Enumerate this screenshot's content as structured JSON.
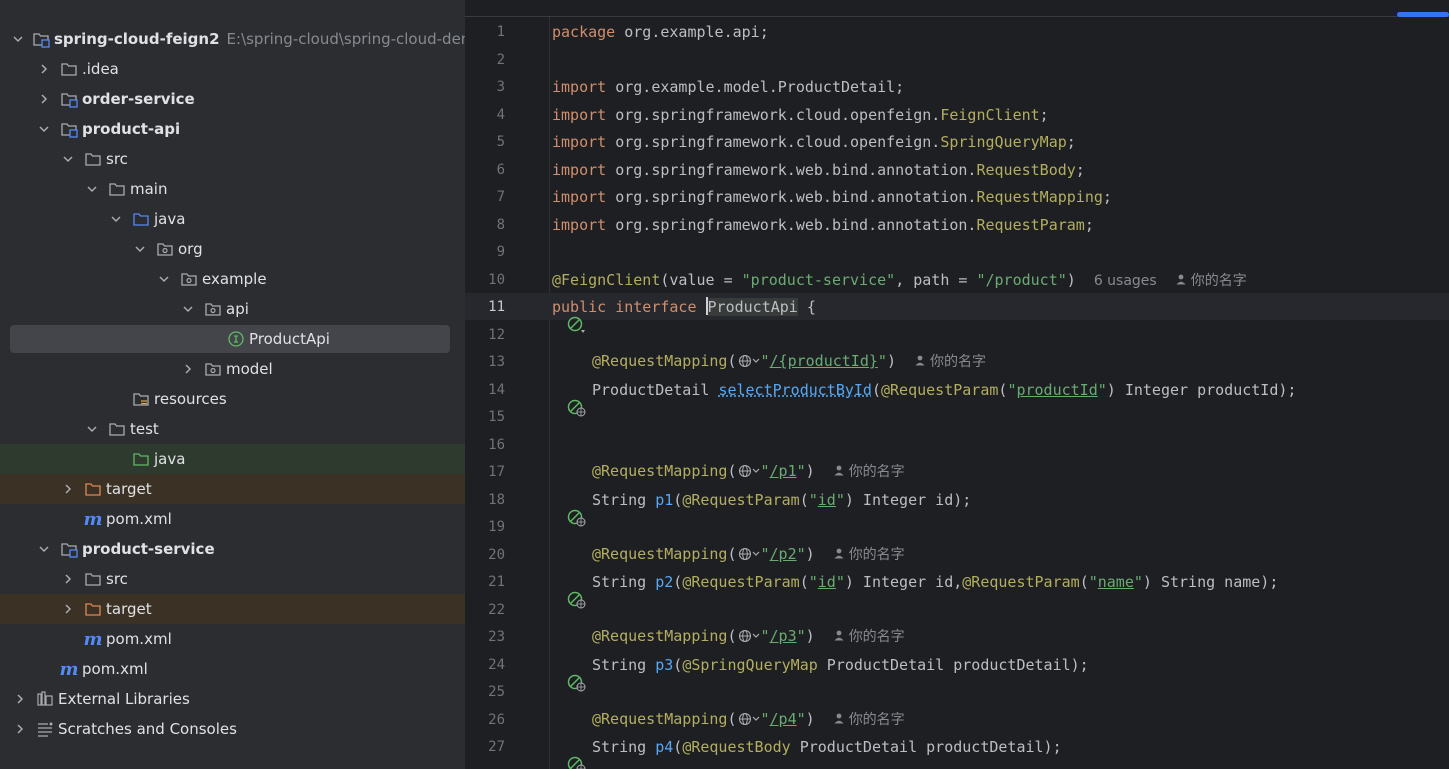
{
  "tree": {
    "project": {
      "name": "spring-cloud-feign2",
      "path": "E:\\spring-cloud\\spring-cloud-dem"
    },
    "items": [
      {
        "label": ".idea"
      },
      {
        "label": "order-service"
      },
      {
        "label": "product-api"
      },
      {
        "label": "src"
      },
      {
        "label": "main"
      },
      {
        "label": "java"
      },
      {
        "label": "org"
      },
      {
        "label": "example"
      },
      {
        "label": "api"
      },
      {
        "label": "ProductApi"
      },
      {
        "label": "model"
      },
      {
        "label": "resources"
      },
      {
        "label": "test"
      },
      {
        "label": "java"
      },
      {
        "label": "target"
      },
      {
        "label": "pom.xml"
      },
      {
        "label": "product-service"
      },
      {
        "label": "src"
      },
      {
        "label": "target"
      },
      {
        "label": "pom.xml"
      },
      {
        "label": "pom.xml"
      },
      {
        "label": "External Libraries"
      },
      {
        "label": "Scratches and Consoles"
      }
    ],
    "maven_glyph": "m"
  },
  "editor": {
    "line_numbers": [
      "1",
      "2",
      "3",
      "4",
      "5",
      "6",
      "7",
      "8",
      "9",
      "10",
      "11",
      "12",
      "13",
      "14",
      "15",
      "16",
      "17",
      "18",
      "19",
      "20",
      "21",
      "22",
      "23",
      "24",
      "25",
      "26",
      "27"
    ],
    "tokens": {
      "package_kw": "package",
      "package_name": " org.example.api;",
      "import_kw": "import",
      "imp3": " org.example.model.ProductDetail;",
      "imp4a": " org.springframework.cloud.openfeign.",
      "imp4b": "FeignClient",
      "imp5a": " org.springframework.cloud.openfeign.",
      "imp5b": "SpringQueryMap",
      "imp6a": " org.springframework.web.bind.annotation.",
      "imp6b": "RequestBody",
      "imp7a": " org.springframework.web.bind.annotation.",
      "imp7b": "RequestMapping",
      "imp8a": " org.springframework.web.bind.annotation.",
      "imp8b": "RequestParam",
      "semicolon": ";",
      "feign_ann": "@FeignClient",
      "feign_args1": "(value = ",
      "feign_value": "\"product-service\"",
      "feign_args2": ", path = ",
      "feign_path": "\"/product\"",
      "feign_close": ")",
      "usages": "6 usages",
      "author": "你的名字",
      "public_kw": "public",
      "interface_kw": "interface",
      "class_name": "ProductApi",
      "open_brace": " {",
      "rm": "@RequestMapping",
      "paren_open": "(",
      "paren_close": ")",
      "quote": "\"",
      "m1_path": "/{productId}",
      "m1_ret": "ProductDetail ",
      "m1_name": "selectProductById",
      "rp": "@RequestParam",
      "m1_param": "productId",
      "m1_tail": ") Integer productId);",
      "m2_path": "/p1",
      "string_type": "String ",
      "m2_name": "p1",
      "id_param": "id",
      "m2_tail": ") Integer id);",
      "m3_path": "/p2",
      "m3_name": "p2",
      "m3_mid": ") Integer id,",
      "name_param": "name",
      "m3_tail": ") String name);",
      "m4_path": "/p3",
      "m4_name": "p3",
      "sqm": "@SpringQueryMap",
      "m4_tail": " ProductDetail productDetail);",
      "m5_path": "/p4",
      "m5_name": "p4",
      "rb": "@RequestBody",
      "m5_tail": " ProductDetail productDetail);"
    }
  },
  "colors": {
    "keyword": "#cf8e6d",
    "annotation": "#b3ae60",
    "string": "#6aab73",
    "method": "#56a8f5",
    "text": "#bcbec4",
    "accent": "#3574f0"
  },
  "icons": {
    "tree_chevrons": "chevron-icon",
    "folders": "folder-icon",
    "module": "module-icon",
    "package": "package-icon",
    "interface": "interface-icon",
    "maven": "maven-icon",
    "library": "library-icon",
    "scratches": "scratches-icon",
    "gutter": "feign-mapping-icon"
  }
}
